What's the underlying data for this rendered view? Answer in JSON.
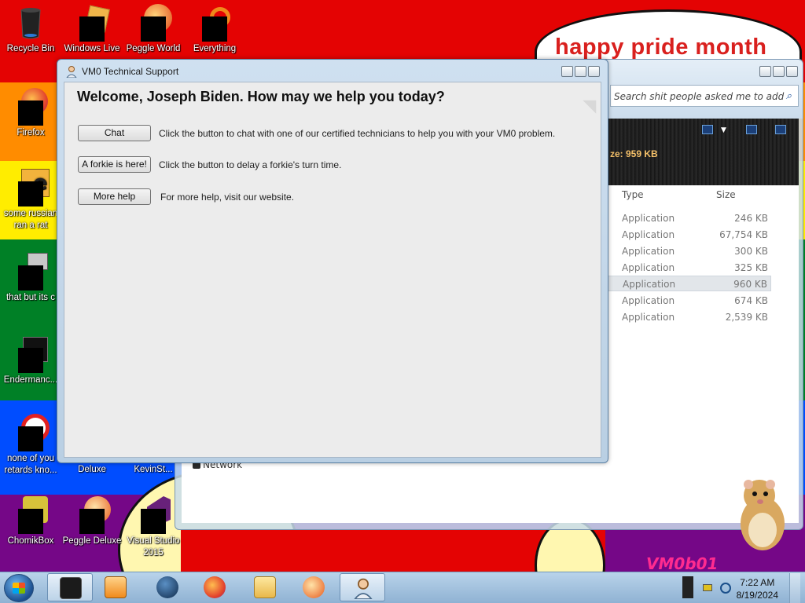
{
  "desktop": {
    "banner_text": "happy pride month",
    "logo_text": "VM0b01",
    "icons": [
      {
        "label": "Recycle Bin"
      },
      {
        "label": "Windows Live"
      },
      {
        "label": "Peggle World"
      },
      {
        "label": "Everything"
      },
      {
        "label": "Firefox"
      },
      {
        "label": "some russian ran a rat"
      },
      {
        "label": "that but its c"
      },
      {
        "label": "Endermanc..."
      },
      {
        "label": "none of you retards kno..."
      },
      {
        "label": "Deluxe"
      },
      {
        "label": "KevinSt..."
      },
      {
        "label": "ChomikBox"
      },
      {
        "label": "Peggle Deluxe"
      },
      {
        "label": "Visual Studio 2015"
      }
    ]
  },
  "explorer": {
    "search_placeholder": "Search shit people asked me to add",
    "size_info": "ze: 959 KB",
    "col_type": "Type",
    "col_size": "Size",
    "rows": [
      {
        "type": "Application",
        "size": "246 KB"
      },
      {
        "type": "Application",
        "size": "67,754 KB"
      },
      {
        "type": "Application",
        "size": "300 KB"
      },
      {
        "type": "Application",
        "size": "325 KB"
      },
      {
        "type": "Application",
        "size": "960 KB",
        "selected": true
      },
      {
        "type": "Application",
        "size": "674 KB"
      },
      {
        "type": "Application",
        "size": "2,539 KB"
      }
    ],
    "nav_network": "Network"
  },
  "dialog": {
    "title": "VM0 Technical Support",
    "heading": "Welcome, Joseph Biden. How may we help you today?",
    "chat_label": "Chat",
    "chat_desc": "Click the button to chat with one of our certified technicians to help you with your VM0 problem.",
    "forkie_label": "A forkie is here!",
    "forkie_desc": "Click the button to delay a forkie's turn time.",
    "more_label": "More help",
    "more_desc": "For more help, visit our website."
  },
  "taskbar": {
    "time": "7:22 AM",
    "date": "8/19/2024"
  }
}
